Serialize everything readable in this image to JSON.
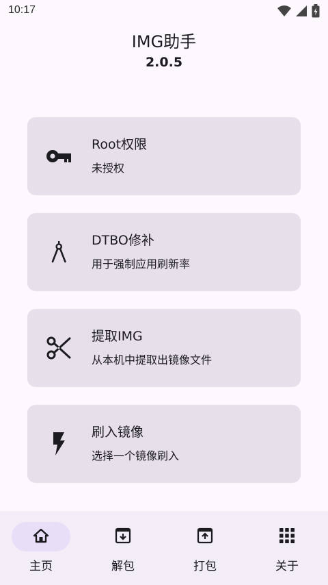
{
  "status_bar": {
    "time": "10:17",
    "icons": [
      "wifi-icon",
      "signal-icon",
      "battery-icon"
    ]
  },
  "header": {
    "title": "IMG助手",
    "version": "2.0.5"
  },
  "cards": [
    {
      "icon": "key-icon",
      "title": "Root权限",
      "subtitle": "未授权"
    },
    {
      "icon": "compass-icon",
      "title": "DTBO修补",
      "subtitle": "用于强制应用刷新率"
    },
    {
      "icon": "scissors-icon",
      "title": "提取IMG",
      "subtitle": "从本机中提取出镜像文件"
    },
    {
      "icon": "flash-icon",
      "title": "刷入镜像",
      "subtitle": "选择一个镜像刷入"
    }
  ],
  "bottom_nav": {
    "items": [
      {
        "icon": "home-icon",
        "label": "主页",
        "active": true
      },
      {
        "icon": "unarchive-icon",
        "label": "解包",
        "active": false
      },
      {
        "icon": "archive-icon",
        "label": "打包",
        "active": false
      },
      {
        "icon": "apps-grid-icon",
        "label": "关于",
        "active": false
      }
    ]
  },
  "colors": {
    "background": "#fdf8fd",
    "card": "#e7e0eb",
    "nav_background": "#f3edf7",
    "nav_active_pill": "#e8def8",
    "icon": "#1c1b1f"
  }
}
